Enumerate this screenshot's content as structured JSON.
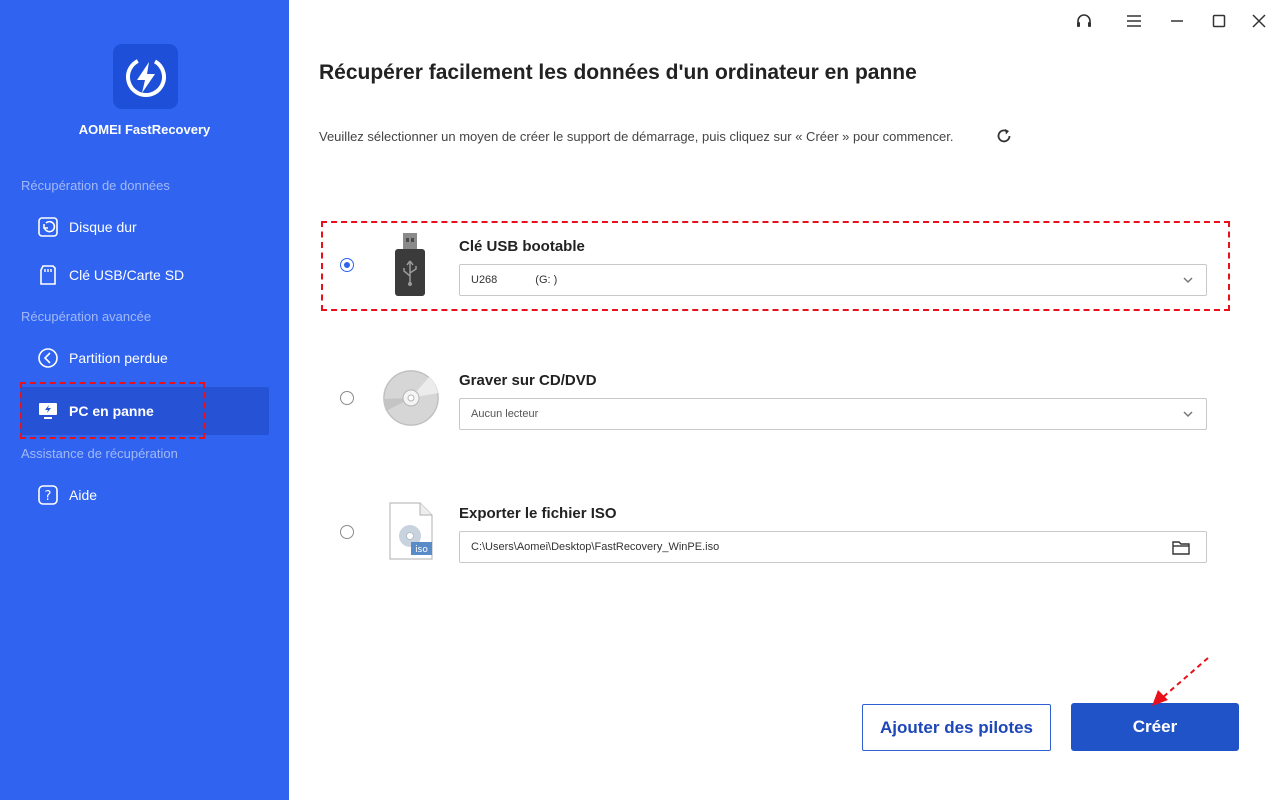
{
  "app": {
    "name": "AOMEI FastRecovery"
  },
  "sidebar": {
    "sections": [
      {
        "label": "Récupération de données"
      },
      {
        "label": "Récupération avancée"
      },
      {
        "label": "Assistance de récupération"
      }
    ],
    "items": [
      {
        "label": "Disque dur",
        "icon": "disk-restore-icon"
      },
      {
        "label": "Clé USB/Carte SD",
        "icon": "sd-card-icon"
      },
      {
        "label": "Partition perdue",
        "icon": "partition-icon"
      },
      {
        "label": "PC en panne",
        "icon": "crashed-pc-icon",
        "active": true
      },
      {
        "label": "Aide",
        "icon": "help-icon"
      }
    ]
  },
  "main": {
    "title": "Récupérer facilement les données d'un ordinateur en panne",
    "subtitle": "Veuillez sélectionner un moyen de créer le support de démarrage, puis cliquez sur « Créer » pour commencer.",
    "options": [
      {
        "title": "Clé USB bootable",
        "device": "U268",
        "drive": "(G: )",
        "selected": true
      },
      {
        "title": "Graver sur CD/DVD",
        "value": "Aucun lecteur",
        "selected": false
      },
      {
        "title": "Exporter le fichier ISO",
        "value": "C:\\Users\\Aomei\\Desktop\\FastRecovery_WinPE.iso",
        "iso_badge": "iso",
        "selected": false
      }
    ],
    "buttons": {
      "add_drivers": "Ajouter des pilotes",
      "create": "Créer"
    }
  },
  "colors": {
    "sidebar_bg": "#2f63f0",
    "primary_button": "#2153c8",
    "annotation": "#e8101a"
  }
}
